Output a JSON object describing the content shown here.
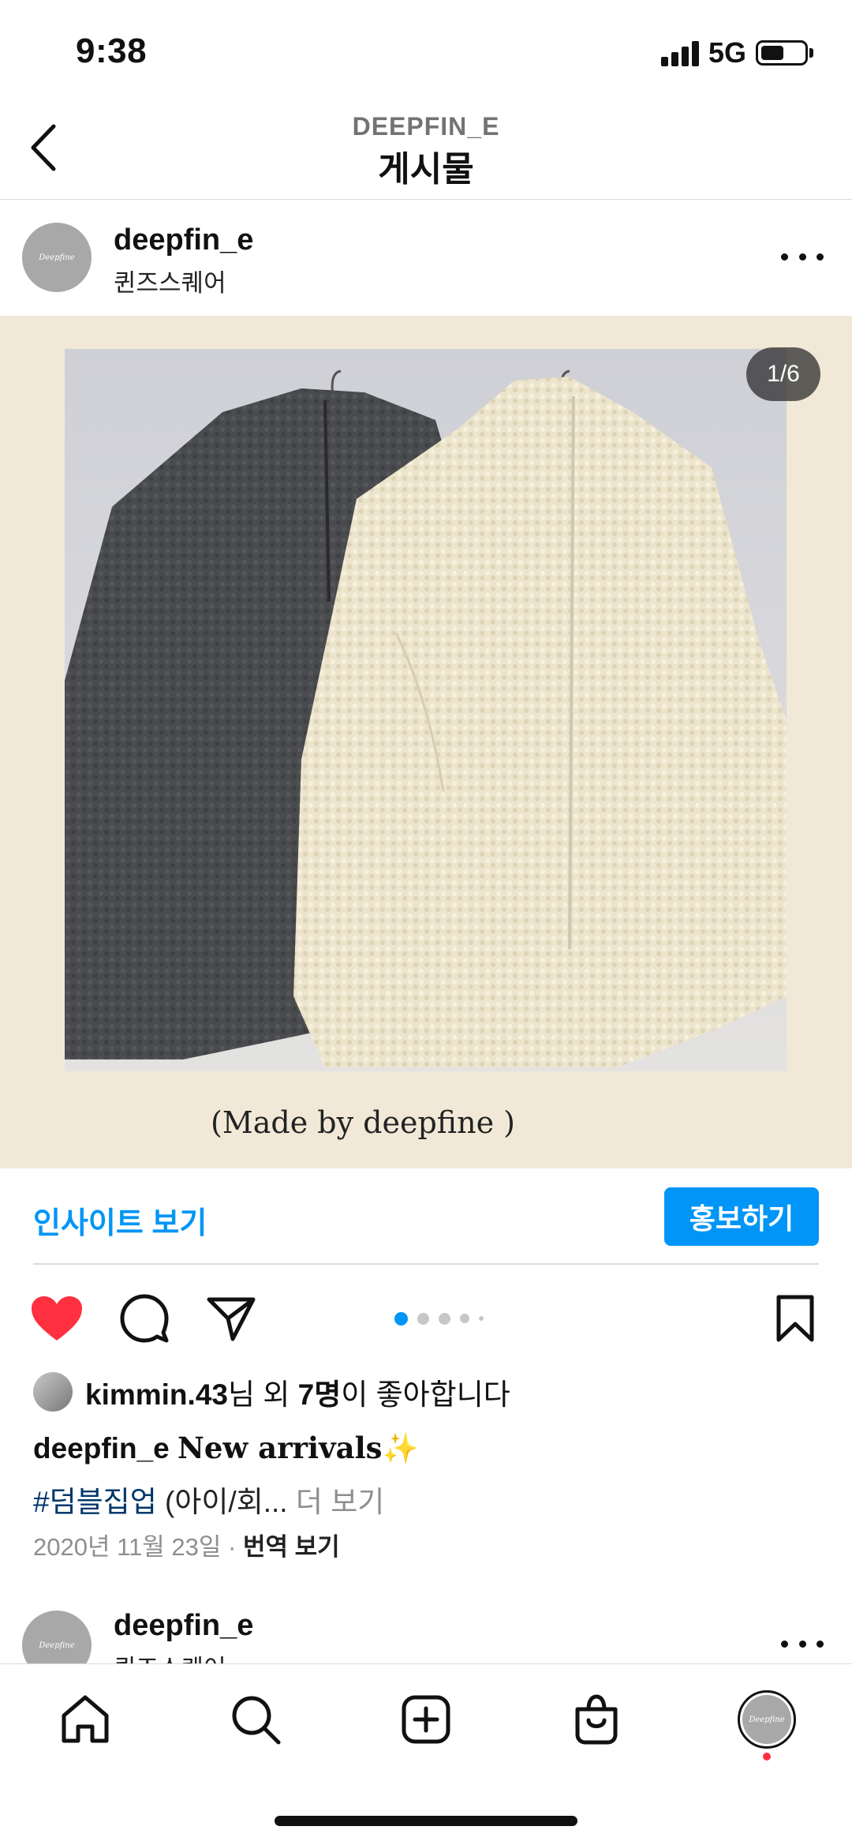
{
  "status_bar": {
    "time": "9:38",
    "network": "5G"
  },
  "header": {
    "subtitle": "DEEPFIN_E",
    "title": "게시물"
  },
  "post": {
    "username": "deepfin_e",
    "location": "퀸즈스퀘어",
    "avatar_text": "Deepfine",
    "image_counter": "1/6",
    "image_caption": "(Made by deepfine )"
  },
  "insight": {
    "link": "인사이트 보기",
    "promote": "홍보하기"
  },
  "likes": {
    "user": "kimmin.43",
    "mid": "님 외 ",
    "count": "7명",
    "end": "이 좋아합니다"
  },
  "caption": {
    "username": "deepfin_e",
    "text": "New arrivals",
    "emoji": "✨",
    "hashtag": "#덤블집업",
    "rest": " (아이/회...",
    "more": " 더 보기"
  },
  "meta": {
    "date": "2020년 11월 23일",
    "separator": " · ",
    "translate": "번역 보기"
  },
  "next_post": {
    "username": "deepfin_e",
    "location": "퀸즈스퀘어"
  },
  "colors": {
    "accent": "#0095f6",
    "like": "#ff3040",
    "hashtag": "#00376b"
  },
  "icons": [
    "back-icon",
    "more-icon",
    "heart-icon",
    "comment-icon",
    "share-icon",
    "bookmark-icon",
    "home-icon",
    "search-icon",
    "create-icon",
    "shop-icon"
  ]
}
